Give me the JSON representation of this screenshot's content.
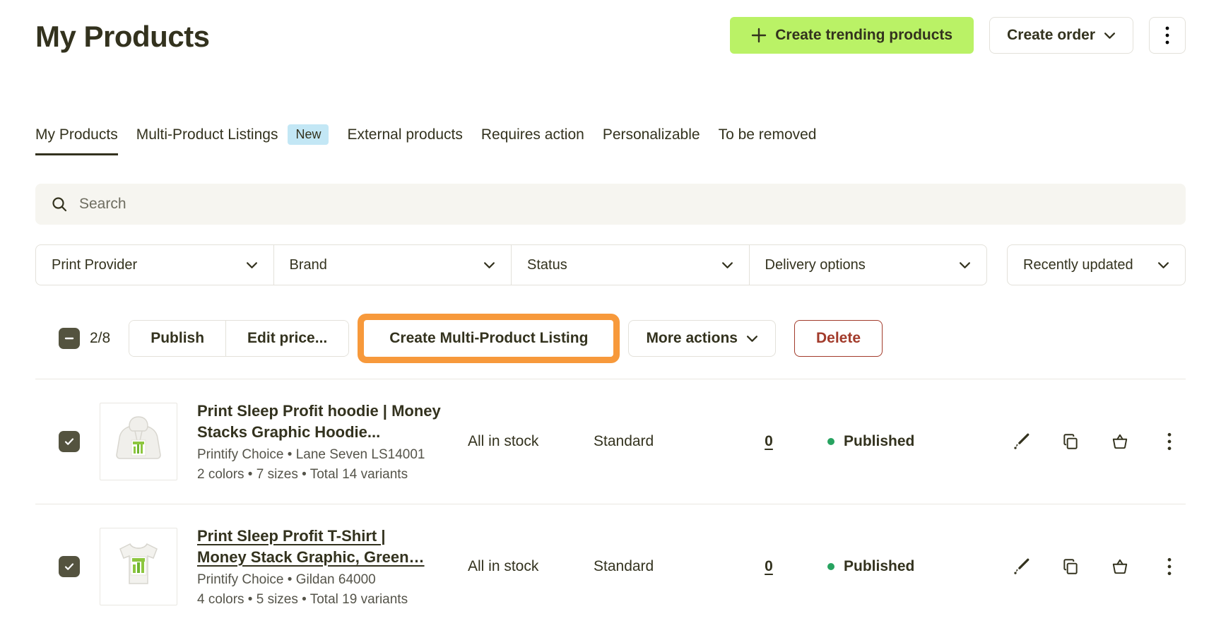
{
  "colors": {
    "ink": "#33321e",
    "accent-green": "#baf266",
    "accent-orange": "#f7993b",
    "badge-blue": "#c3e7f5",
    "danger": "#a23b2b",
    "success": "#27a360",
    "border": "#e3e1da",
    "search-bg": "#f6f5f0",
    "checkbox": "#54533f"
  },
  "header": {
    "title": "My Products",
    "create_trending_label": "Create trending products",
    "create_order_label": "Create order"
  },
  "tabs": {
    "my_products": "My Products",
    "multi_product_listings": "Multi-Product Listings",
    "new_badge": "New",
    "external_products": "External products",
    "requires_action": "Requires action",
    "personalizable": "Personalizable",
    "to_be_removed": "To be removed"
  },
  "search": {
    "placeholder": "Search"
  },
  "filters": {
    "print_provider": "Print Provider",
    "brand": "Brand",
    "status": "Status",
    "delivery_options": "Delivery options",
    "sort": "Recently updated"
  },
  "bulk_bar": {
    "selection_count": "2/8",
    "publish_label": "Publish",
    "edit_price_label": "Edit price...",
    "create_mpl_label": "Create Multi-Product Listing",
    "more_actions_label": "More actions",
    "delete_label": "Delete"
  },
  "products": {
    "0": {
      "title_line1": "Print Sleep Profit hoodie | Money",
      "title_line2": "Stacks Graphic Hoodie...",
      "subtitle": "Printify Choice • Lane Seven LS14001",
      "meta": "2 colors • 7 sizes • Total 14 variants",
      "stock": "All in stock",
      "delivery": "Standard",
      "orders": "0",
      "status": "Published"
    },
    "1": {
      "title_line1": "Print Sleep Profit T-Shirt |",
      "title_line2": "Money Stack Graphic, Green…",
      "subtitle": "Printify Choice • Gildan 64000",
      "meta": "4 colors • 5 sizes • Total 19 variants",
      "stock": "All in stock",
      "delivery": "Standard",
      "orders": "0",
      "status": "Published"
    }
  }
}
